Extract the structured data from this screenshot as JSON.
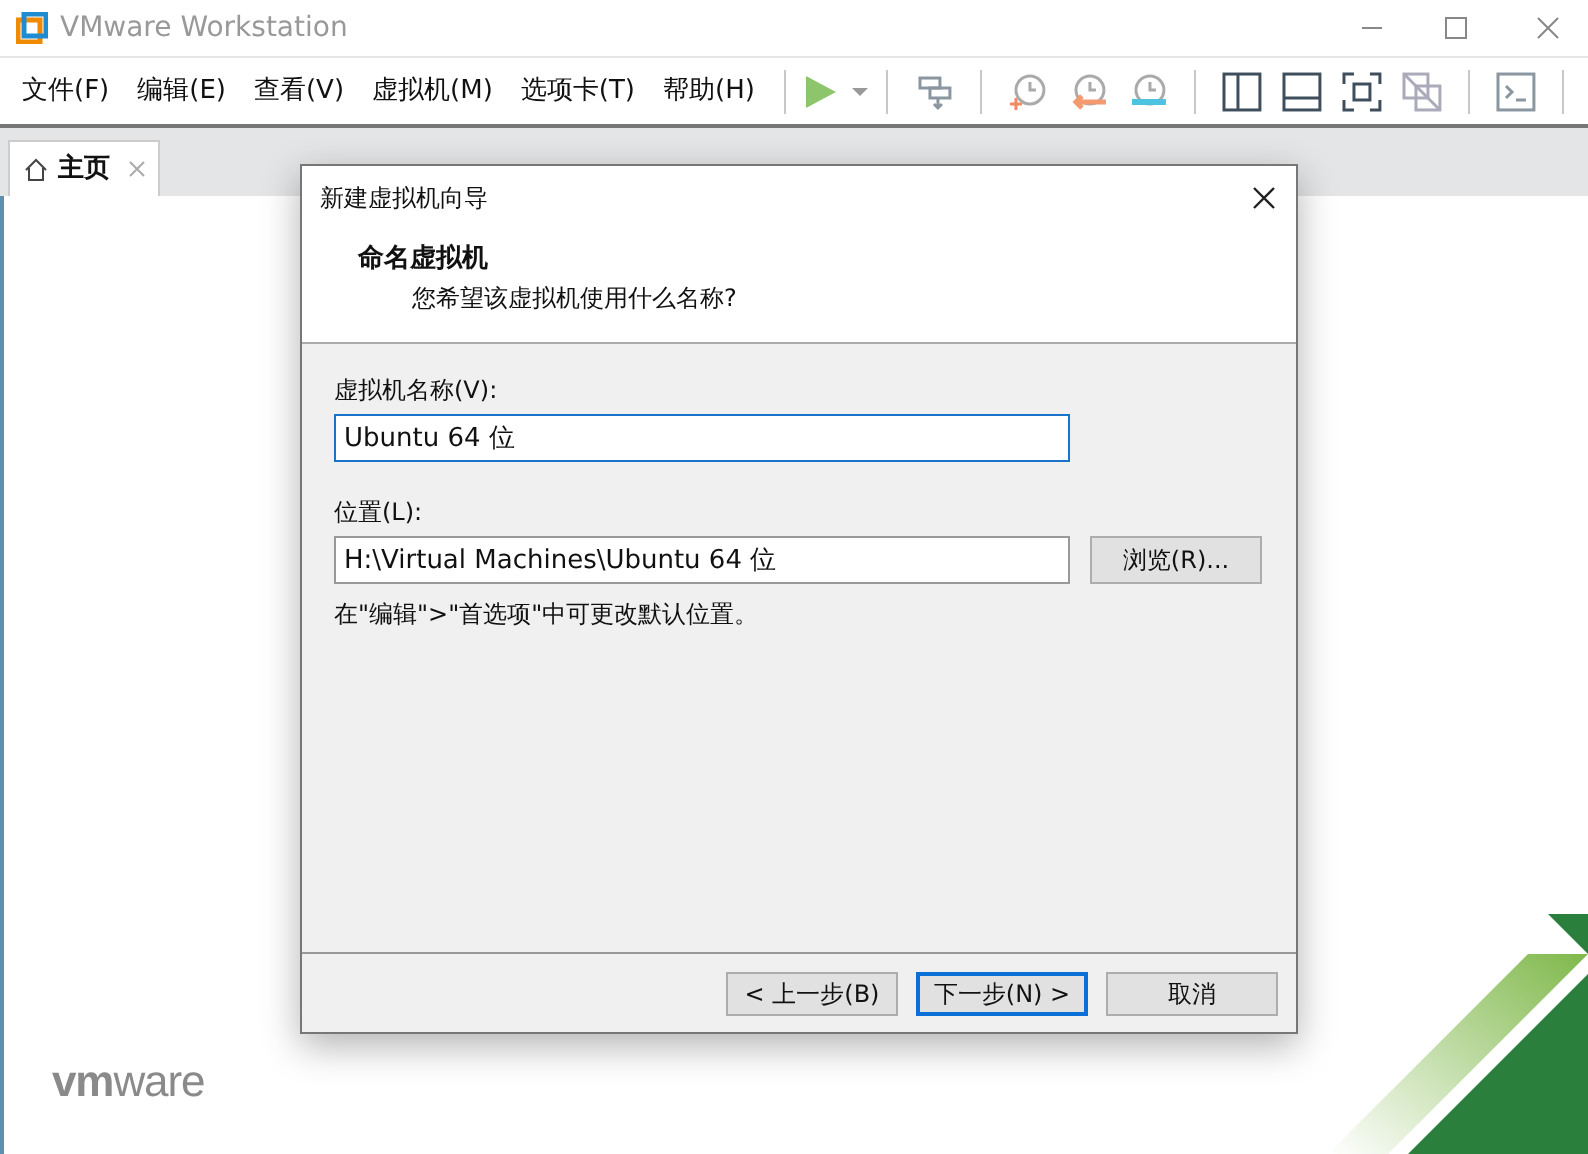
{
  "window": {
    "title": "VMware Workstation"
  },
  "menu": [
    "文件(F)",
    "编辑(E)",
    "查看(V)",
    "虚拟机(M)",
    "选项卡(T)",
    "帮助(H)"
  ],
  "tabs": [
    {
      "label": "主页",
      "selected": true
    }
  ],
  "logo": "**vm**ware",
  "dialog": {
    "title": "新建虚拟机向导",
    "heading": "命名虚拟机",
    "subheading": "您希望该虚拟机使用什么名称?",
    "name_label": "虚拟机名称(V):",
    "name_value": "Ubuntu 64 位",
    "location_label": "位置(L):",
    "location_value": "H:\\Virtual Machines\\Ubuntu 64 位",
    "browse_button": "浏览(R)...",
    "hint": "在\"编辑\">\"首选项\"中可更改默认位置。",
    "buttons": [
      {
        "label": "< 上一步(B)",
        "selected": false
      },
      {
        "label": "下一步(N) >",
        "selected": true
      },
      {
        "label": "取消",
        "selected": false
      }
    ]
  }
}
